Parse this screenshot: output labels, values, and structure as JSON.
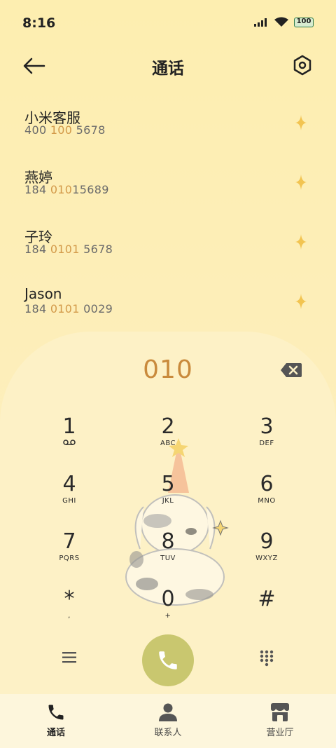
{
  "status": {
    "time": "8:16",
    "battery": "100"
  },
  "header": {
    "title": "通话"
  },
  "contacts": [
    {
      "name": "小米客服",
      "num_pre": "400 ",
      "num_hl": "100",
      "num_post": " 5678"
    },
    {
      "name": "燕婷",
      "num_pre": "184 ",
      "num_hl": "010",
      "num_post": "15689"
    },
    {
      "name": "子玲",
      "num_pre": "184 ",
      "num_hl": "0101",
      "num_post": " 5678"
    },
    {
      "name": "Jason",
      "num_pre": "184 ",
      "num_hl": "0101",
      "num_post": " 0029"
    }
  ],
  "dialer": {
    "input": "010",
    "keys": [
      {
        "digit": "1",
        "sub": ""
      },
      {
        "digit": "2",
        "sub": "ABC"
      },
      {
        "digit": "3",
        "sub": "DEF"
      },
      {
        "digit": "4",
        "sub": "GHI"
      },
      {
        "digit": "5",
        "sub": "JKL"
      },
      {
        "digit": "6",
        "sub": "MNO"
      },
      {
        "digit": "7",
        "sub": "PQRS"
      },
      {
        "digit": "8",
        "sub": "TUV"
      },
      {
        "digit": "9",
        "sub": "WXYZ"
      },
      {
        "digit": "*",
        "sub": ","
      },
      {
        "digit": "0",
        "sub": "+"
      },
      {
        "digit": "#",
        "sub": ""
      }
    ]
  },
  "nav": {
    "calls": "通话",
    "contacts": "联系人",
    "store": "营业厅"
  },
  "colors": {
    "highlight": "#d39a4a",
    "call_button": "#c9c76f",
    "background": "#fdeeb0"
  }
}
